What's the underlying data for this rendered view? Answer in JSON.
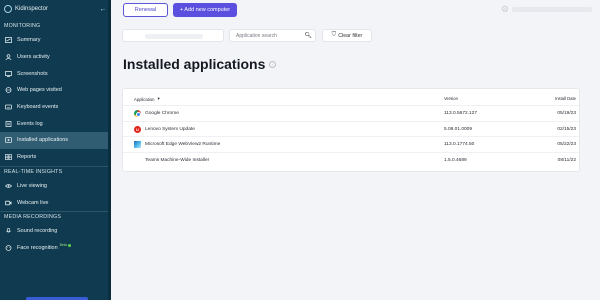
{
  "app": {
    "brand": "Kidinspector"
  },
  "sidebar": {
    "sections": [
      {
        "title": "MONITORING",
        "items": [
          {
            "label": "Summary",
            "icon": "summary-icon",
            "active": false
          },
          {
            "label": "Users activity",
            "icon": "users-activity-icon",
            "active": false
          },
          {
            "label": "Screenshots",
            "icon": "screenshots-icon",
            "active": false
          },
          {
            "label": "Web pages visited",
            "icon": "globe-icon",
            "active": false
          },
          {
            "label": "Keyboard events",
            "icon": "keyboard-icon",
            "active": false
          },
          {
            "label": "Events log",
            "icon": "events-log-icon",
            "active": false
          },
          {
            "label": "Installed applications",
            "icon": "applications-icon",
            "active": true
          },
          {
            "label": "Reports",
            "icon": "reports-icon",
            "active": false
          }
        ]
      },
      {
        "title": "REAL-TIME INSIGHTS",
        "items": [
          {
            "label": "Live viewing",
            "icon": "eye-icon",
            "active": false
          },
          {
            "label": "Webcam live",
            "icon": "webcam-icon",
            "active": false
          }
        ]
      },
      {
        "title": "MEDIA RECORDINGS",
        "items": [
          {
            "label": "Sound recording",
            "icon": "microphone-icon",
            "active": false
          },
          {
            "label": "Face recognition",
            "icon": "face-recognition-icon",
            "active": false,
            "badge": "Beta"
          }
        ]
      }
    ]
  },
  "toolbar": {
    "renewal_label": "Renewal",
    "add_computer_label": "+ Add new computer"
  },
  "filters": {
    "app_search_placeholder": "Application search",
    "clear_label": "Clear filter"
  },
  "page": {
    "title": "Installed applications"
  },
  "table": {
    "headers": {
      "application": "Application",
      "version": "Version",
      "install_date": "Install Date"
    },
    "rows": [
      {
        "name": "Google Chrome",
        "version": "113.0.5672.127",
        "date": "05/19/23",
        "icon": "chrome-icon"
      },
      {
        "name": "Lenovo System Update",
        "version": "5.08.01.0009",
        "date": "02/15/23",
        "icon": "lenovo-icon"
      },
      {
        "name": "Microsoft Edge WebView2 Runtime",
        "version": "113.0.1774.50",
        "date": "05/22/23",
        "icon": "edge-icon"
      },
      {
        "name": "Teams Machine-Wide Installer",
        "version": "1.5.0.4689",
        "date": "08/11/22",
        "icon": "teams-icon"
      }
    ]
  },
  "colors": {
    "sidebar_bg": "#0f3a4f",
    "sidebar_active": "#315d72",
    "accent": "#5b4fe0"
  }
}
